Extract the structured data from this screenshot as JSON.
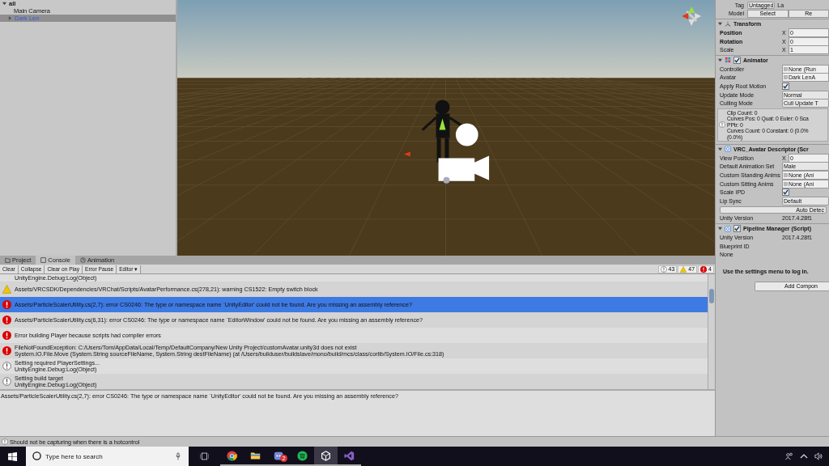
{
  "hierarchy": {
    "root": "all",
    "items": [
      {
        "label": "Main Camera",
        "selected": false,
        "has_children": false
      },
      {
        "label": "Dark Len",
        "selected": true,
        "has_children": true
      }
    ]
  },
  "inspector": {
    "tag_label": "Tag",
    "tag_value": "Untagged",
    "layer_label": "La",
    "model_label": "Model",
    "model_buttons": [
      "Select",
      "Re"
    ],
    "components": [
      {
        "title": "Transform",
        "kind": "transform",
        "rows": [
          {
            "kind": "vector",
            "label": "Position",
            "axis": "X",
            "value": "0",
            "modified": true
          },
          {
            "kind": "vector",
            "label": "Rotation",
            "axis": "X",
            "value": "0",
            "modified": true
          },
          {
            "kind": "vector",
            "label": "Scale",
            "axis": "X",
            "value": "1",
            "modified": false
          }
        ]
      },
      {
        "title": "Animator",
        "kind": "animator",
        "enabled": true,
        "rows": [
          {
            "kind": "object",
            "label": "Controller",
            "value": "None (Run"
          },
          {
            "kind": "object",
            "label": "Avatar",
            "value": "Dark LenA"
          },
          {
            "kind": "checkbox",
            "label": "Apply Root Motion",
            "checked": true
          },
          {
            "kind": "dropdown",
            "label": "Update Mode",
            "value": "Normal"
          },
          {
            "kind": "dropdown",
            "label": "Culling Mode",
            "value": "Cull Update T"
          },
          {
            "kind": "info",
            "lines": [
              "Clip Count: 0",
              "Curves Pos: 0 Quat: 0 Euler: 0 Sca",
              "PPtr: 0",
              "Curves Count: 0 Constant: 0 (0.0%",
              "(0.0%)"
            ]
          }
        ]
      },
      {
        "title": "VRC_Avatar Descriptor (Scr",
        "kind": "script",
        "rows": [
          {
            "kind": "vector",
            "label": "View Position",
            "axis": "X",
            "value": "0",
            "modified": false
          },
          {
            "kind": "dropdown",
            "label": "Default Animation Set",
            "value": "Male"
          },
          {
            "kind": "object",
            "label": "Custom Standing Anims",
            "value": "None (Ani"
          },
          {
            "kind": "object",
            "label": "Custom Sitting Anims",
            "value": "None (Ani"
          },
          {
            "kind": "checkbox",
            "label": "Scale IPD",
            "checked": true
          },
          {
            "kind": "dropdown",
            "label": "Lip Sync",
            "value": "Default"
          },
          {
            "kind": "button",
            "label": "Auto Detec"
          },
          {
            "kind": "text",
            "label": "Unity Version",
            "value": "2017.4.28f1"
          }
        ]
      },
      {
        "title": "Pipeline Manager (Script)",
        "kind": "script",
        "enabled": true,
        "rows": [
          {
            "kind": "text",
            "label": "Unity Version",
            "value": "2017.4.28f1"
          },
          {
            "kind": "label",
            "label": "Blueprint ID"
          },
          {
            "kind": "label",
            "label": "None"
          },
          {
            "kind": "note",
            "label": "Use the settings menu to log in."
          }
        ]
      }
    ],
    "add_button": "Add Compon"
  },
  "console": {
    "tabs": [
      {
        "label": "Project",
        "kind": "folder",
        "selected": false
      },
      {
        "label": "Console",
        "kind": "console",
        "selected": true
      },
      {
        "label": "Animation",
        "kind": "clock",
        "selected": false
      }
    ],
    "toolbar": [
      "Clear",
      "Collapse",
      "Clear on Play",
      "Error Pause",
      "Editor ▾"
    ],
    "counts": [
      {
        "kind": "info",
        "value": "43"
      },
      {
        "kind": "warning",
        "value": "47"
      },
      {
        "kind": "error",
        "value": "4"
      }
    ],
    "entries": [
      {
        "kind": "none",
        "selected": false,
        "lines": [
          "UnityEngine.Debug:Log(Object)"
        ]
      },
      {
        "kind": "warning",
        "selected": false,
        "lines": [
          "Assets/VRCSDK/Dependencies/VRChat/Scripts/AvatarPerformance.cs(278,21): warning CS1522: Empty switch block"
        ]
      },
      {
        "kind": "error",
        "selected": true,
        "lines": [
          "Assets/ParticleScalerUtility.cs(2,7): error CS0246: The type or namespace name `UnityEditor' could not be found. Are you missing an assembly reference?"
        ]
      },
      {
        "kind": "error",
        "selected": false,
        "lines": [
          "Assets/ParticleScalerUtility.cs(6,31): error CS0246: The type or namespace name `EditorWindow' could not be found. Are you missing an assembly reference?"
        ]
      },
      {
        "kind": "error",
        "selected": false,
        "lines": [
          "Error building Player because scripts had compiler errors"
        ]
      },
      {
        "kind": "error",
        "selected": false,
        "lines": [
          "FileNotFoundException: C:/Users/Tom/AppData/Local/Temp/DefaultCompany/New Unity Project/customAvatar.unity3d does not exist",
          "System.IO.File.Move (System.String sourceFileName, System.String destFileName) (at /Users/builduser/buildslave/mono/build/mcs/class/corlib/System.IO/File.cs:318)"
        ]
      },
      {
        "kind": "info",
        "selected": false,
        "lines": [
          "Setting required PlayerSettings...",
          "UnityEngine.Debug:Log(Object)"
        ]
      },
      {
        "kind": "info",
        "selected": false,
        "lines": [
          "Setting build target",
          "UnityEngine.Debug:Log(Object)"
        ]
      }
    ],
    "detail": "Assets/ParticleScalerUtility.cs(2,7): error CS0246: The type or namespace name `UnityEditor' could not be found. Are you missing an assembly reference?"
  },
  "status_bar": "Should not be capturing when there is a hotcontrol",
  "taskbar": {
    "search_placeholder": "Type here to search",
    "apps": [
      {
        "kind": "chrome",
        "active": false
      },
      {
        "kind": "folder",
        "active": false
      },
      {
        "kind": "chat",
        "badge": "2",
        "active": false
      },
      {
        "kind": "spotify",
        "active": false
      },
      {
        "kind": "unity",
        "active": true
      },
      {
        "kind": "visualstudio",
        "active": false
      }
    ]
  }
}
